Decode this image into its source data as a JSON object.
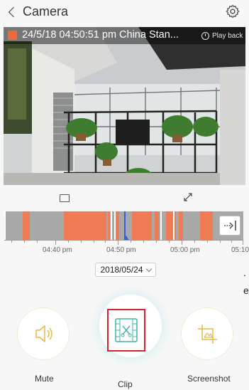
{
  "header": {
    "back_label": "Camera",
    "settings_icon": "gear-icon"
  },
  "video": {
    "timestamp": "24/5/18 04:50:51 pm China Stan...",
    "playback_label": "Play back",
    "rec_color": "#ef6a3a"
  },
  "controls": {
    "snapshot_icon": "rectangle-icon",
    "fullscreen_icon": "expand-icon"
  },
  "timeline": {
    "time_labels": [
      "04:40 pm",
      "04:50 pm",
      "05:00 pm",
      "05:10"
    ],
    "recording_color": "#f07c55",
    "idle_color": "#a9a9a9",
    "playhead_color": "#3a5bd6"
  },
  "date_selector": {
    "value": "2018/05/24"
  },
  "edge_text": {
    "line1": ".",
    "line2": "e"
  },
  "actions": {
    "mute_label": "Mute",
    "clip_label": "Clip",
    "screenshot_label": "Screenshot"
  }
}
